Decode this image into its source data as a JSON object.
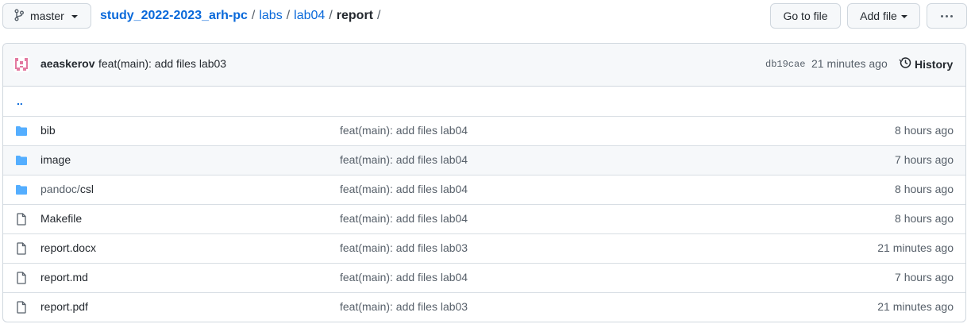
{
  "branch": {
    "label": "master"
  },
  "breadcrumb": {
    "repo": "study_2022-2023_arh-pc",
    "parts": [
      "labs",
      "lab04"
    ],
    "current": "report",
    "sep": "/"
  },
  "buttons": {
    "go_to_file": "Go to file",
    "add_file": "Add file"
  },
  "commit": {
    "author": "aeaskerov",
    "message": "feat(main): add files lab03",
    "sha": "db19cae",
    "time": "21 minutes ago",
    "history_label": "History"
  },
  "parent_dir": "..",
  "files": [
    {
      "type": "dir",
      "name_prefix": "",
      "name": "bib",
      "message": "feat(main): add files lab04",
      "age": "8 hours ago"
    },
    {
      "type": "dir",
      "name_prefix": "",
      "name": "image",
      "message": "feat(main): add files lab04",
      "age": "7 hours ago"
    },
    {
      "type": "dir",
      "name_prefix": "pandoc/",
      "name": "csl",
      "message": "feat(main): add files lab04",
      "age": "8 hours ago"
    },
    {
      "type": "file",
      "name_prefix": "",
      "name": "Makefile",
      "message": "feat(main): add files lab04",
      "age": "8 hours ago"
    },
    {
      "type": "file",
      "name_prefix": "",
      "name": "report.docx",
      "message": "feat(main): add files lab03",
      "age": "21 minutes ago"
    },
    {
      "type": "file",
      "name_prefix": "",
      "name": "report.md",
      "message": "feat(main): add files lab04",
      "age": "7 hours ago"
    },
    {
      "type": "file",
      "name_prefix": "",
      "name": "report.pdf",
      "message": "feat(main): add files lab03",
      "age": "21 minutes ago"
    }
  ],
  "colors": {
    "folder": "#54aeff",
    "link": "#0969da",
    "avatar": "#e37aa1"
  }
}
